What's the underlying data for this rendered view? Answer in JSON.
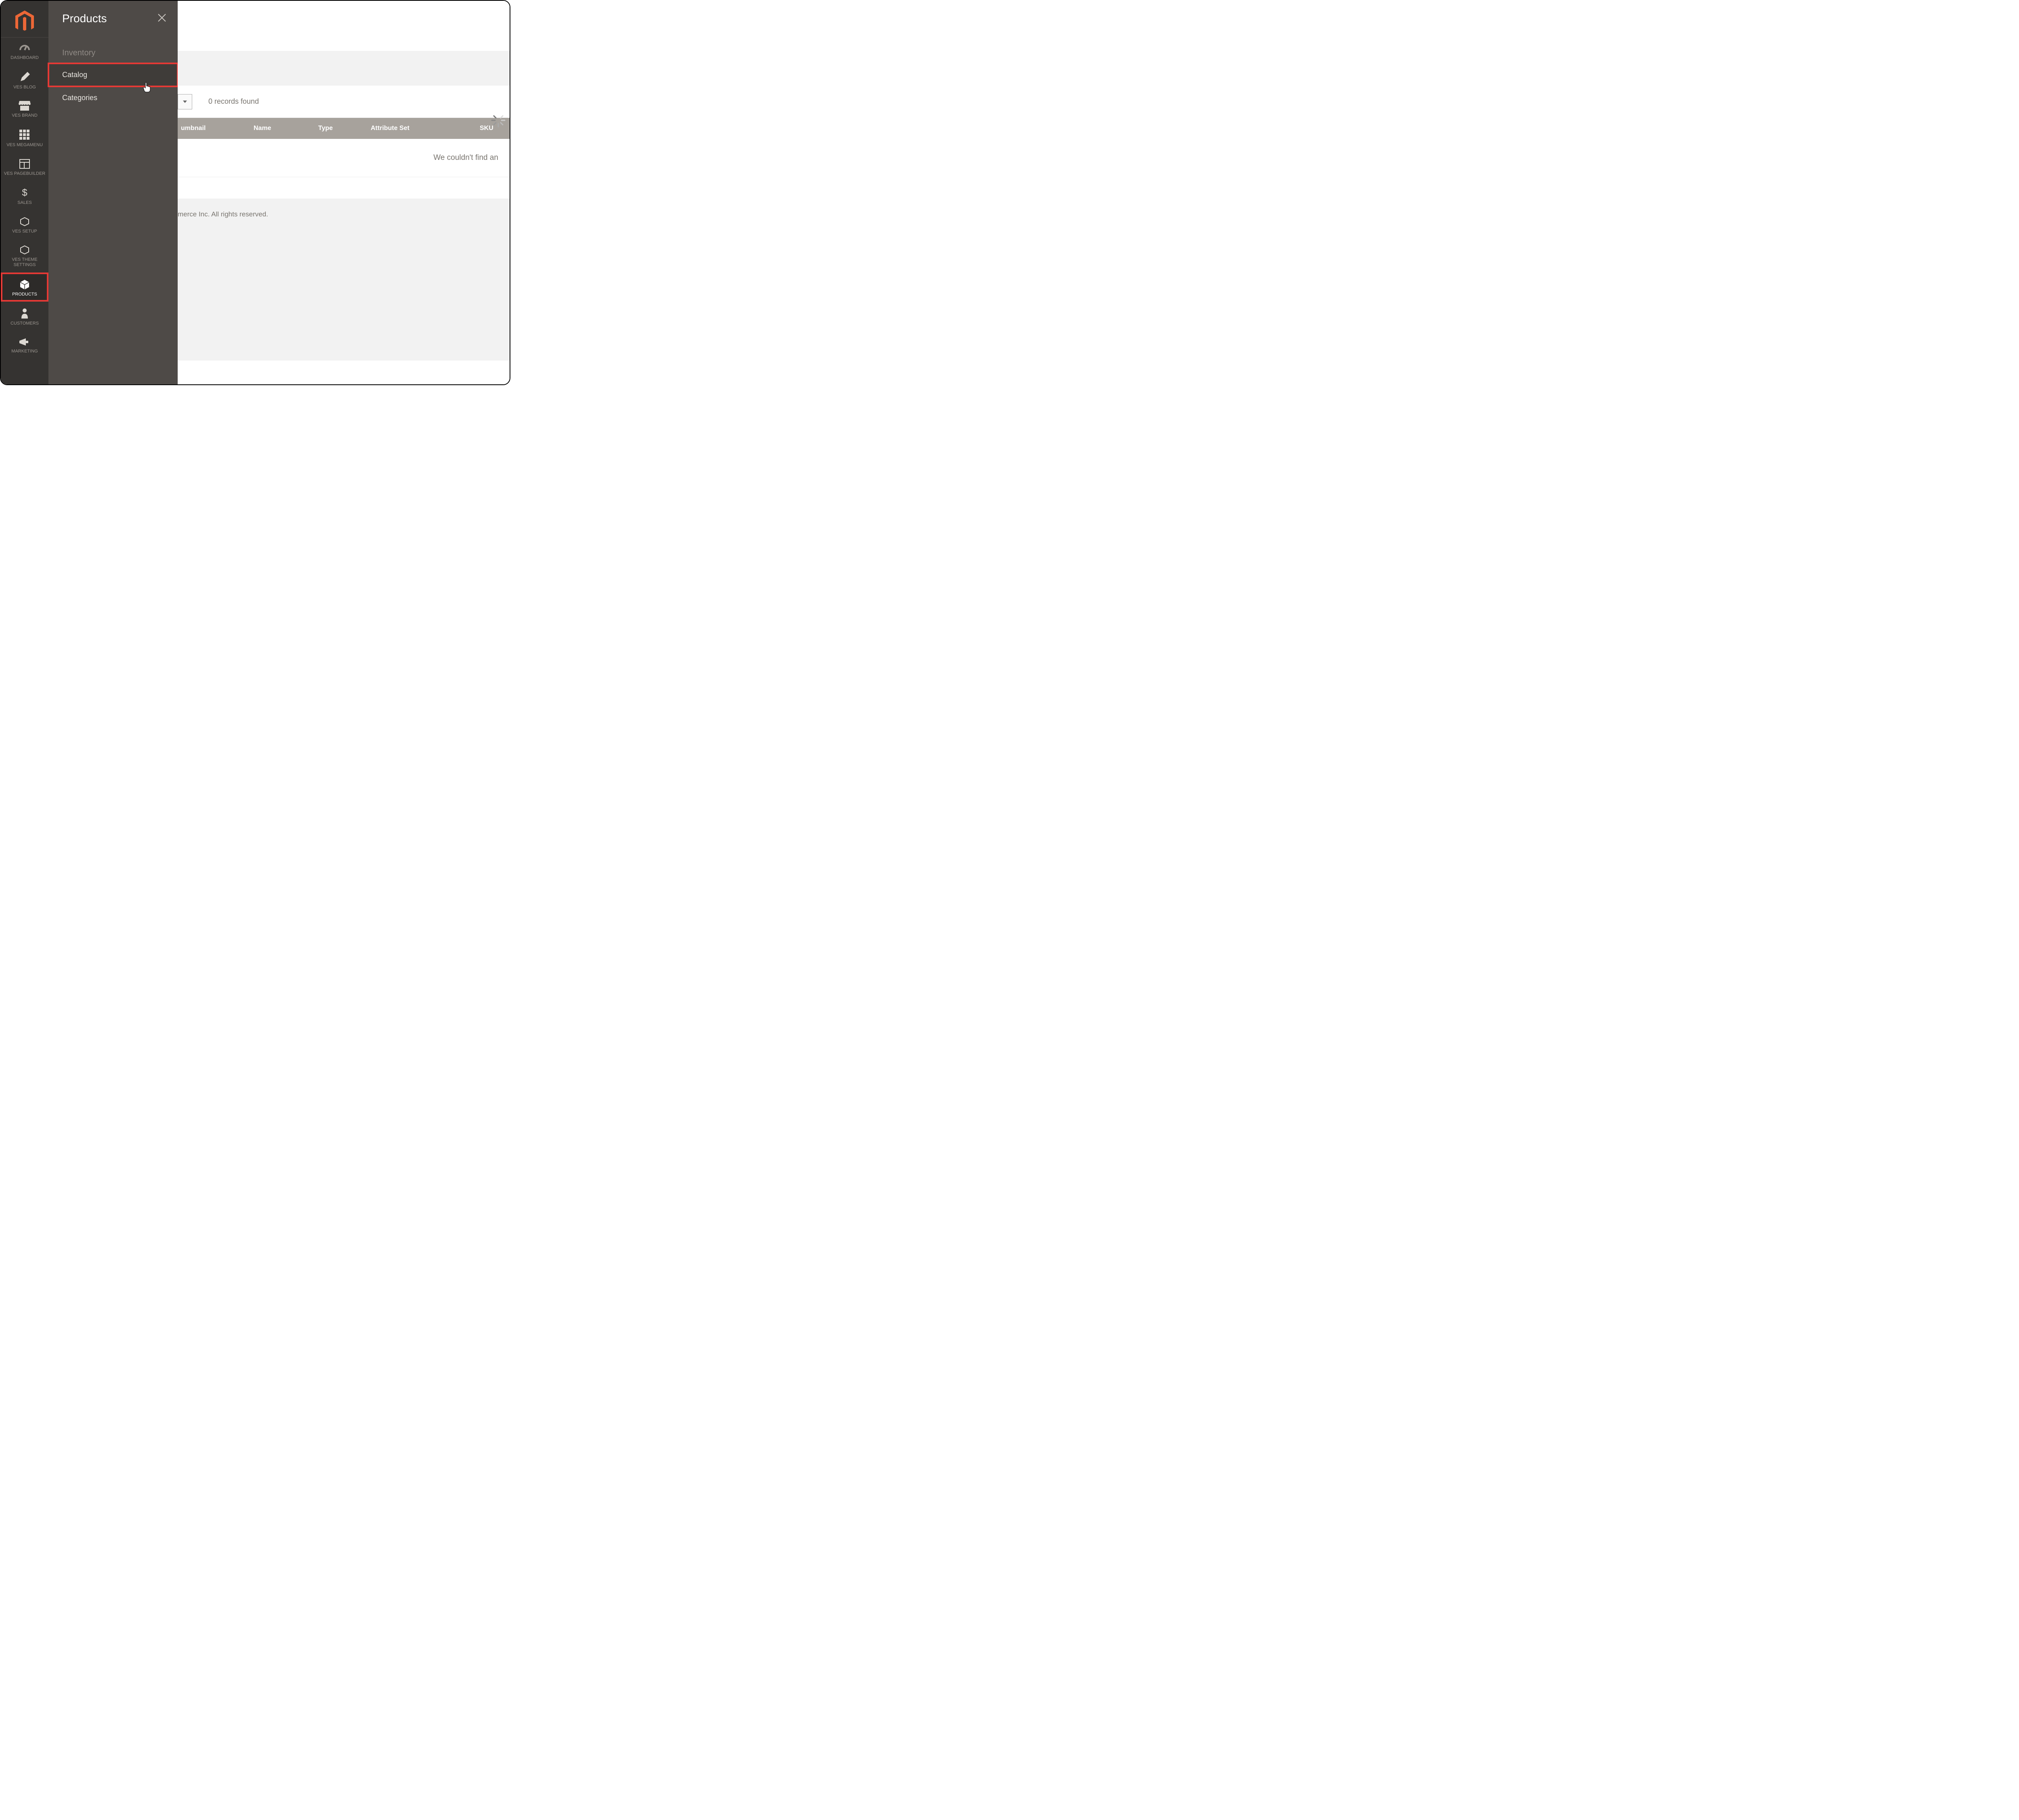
{
  "sidebar": {
    "items": [
      {
        "id": "dashboard",
        "label": "DASHBOARD"
      },
      {
        "id": "vesblog",
        "label": "VES BLOG"
      },
      {
        "id": "vesbrand",
        "label": "VES BRAND"
      },
      {
        "id": "vesmegamenu",
        "label": "VES MEGAMENU"
      },
      {
        "id": "vespagebuilder",
        "label": "VES PAGEBUILDER"
      },
      {
        "id": "sales",
        "label": "SALES"
      },
      {
        "id": "vessetup",
        "label": "VES SETUP"
      },
      {
        "id": "vestheme",
        "label": "VES THEME SETTINGS"
      },
      {
        "id": "products",
        "label": "PRODUCTS"
      },
      {
        "id": "customers",
        "label": "CUSTOMERS"
      },
      {
        "id": "marketing",
        "label": "MARKETING"
      }
    ]
  },
  "submenu": {
    "title": "Products",
    "section_label": "Inventory",
    "items": [
      {
        "id": "catalog",
        "label": "Catalog"
      },
      {
        "id": "categories",
        "label": "Categories"
      }
    ]
  },
  "grid": {
    "records_found": "0 records found",
    "columns": {
      "thumbnail": "umbnail",
      "name": "Name",
      "type": "Type",
      "attribute_set": "Attribute Set",
      "sku": "SKU"
    },
    "empty_message": "We couldn't find an"
  },
  "footer": {
    "copyright": "merce Inc. All rights reserved."
  }
}
